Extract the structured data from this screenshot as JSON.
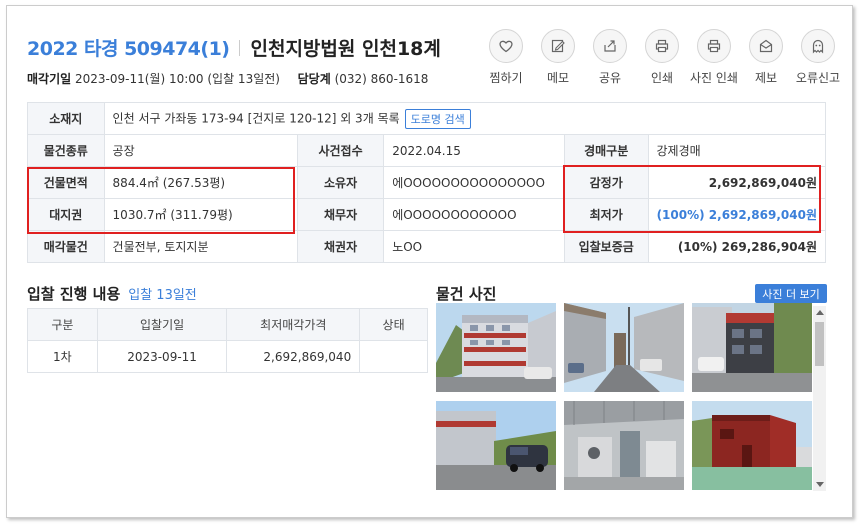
{
  "header": {
    "case_no": "2022 타경 509474(1)",
    "court": "인천지방법원 인천18계",
    "sale_date_label": "매각기일",
    "sale_date": "2023-09-11(월) 10:00 (입찰 13일전)",
    "dept_label": "담당계",
    "dept_phone": "(032) 860-1618"
  },
  "actions": [
    {
      "label": "찜하기",
      "icon": "heart-icon"
    },
    {
      "label": "메모",
      "icon": "memo-icon"
    },
    {
      "label": "공유",
      "icon": "share-icon"
    },
    {
      "label": "인쇄",
      "icon": "print-icon"
    },
    {
      "label": "사진 인쇄",
      "icon": "print-photo-icon"
    },
    {
      "label": "제보",
      "icon": "report-mail-icon"
    },
    {
      "label": "오류신고",
      "icon": "error-report-icon"
    }
  ],
  "info": {
    "location_label": "소재지",
    "location": "인천 서구 가좌동 173-94 [건지로 120-12] 외 3개 목록",
    "road_search": "도로명 검색",
    "type_label": "물건종류",
    "type": "공장",
    "filed_label": "사건접수",
    "filed": "2022.04.15",
    "auction_kind_label": "경매구분",
    "auction_kind": "강제경매",
    "building_area_label": "건물면적",
    "building_area": "884.4㎡ (267.53평)",
    "owner_label": "소유자",
    "owner": "에OOOOOOOOOOOOOOO",
    "appraisal_label": "감정가",
    "appraisal": "2,692,869,040원",
    "land_label": "대지권",
    "land_area": "1030.7㎡ (311.79평)",
    "debtor_label": "채무자",
    "debtor": "에OOOOOOOOOOOO",
    "min_price_label": "최저가",
    "min_price": "(100%) 2,692,869,040원",
    "sale_item_label": "매각물건",
    "sale_item": "건물전부, 토지지분",
    "creditor_label": "채권자",
    "creditor": "노OO",
    "deposit_label": "입찰보증금",
    "deposit": "(10%) 269,286,904원"
  },
  "bid": {
    "title": "입찰 진행 내용",
    "subtitle": "입찰 13일전",
    "columns": [
      "구분",
      "입찰기일",
      "최저매각가격",
      "상태"
    ],
    "rows": [
      {
        "round": "1차",
        "date": "2023-09-11",
        "price": "2,692,869,040",
        "status": ""
      }
    ]
  },
  "photos": {
    "title": "물건 사진",
    "more_button": "사진 더 보기"
  },
  "colors": {
    "accent": "#3b7fd9",
    "highlight_box": "#e02020"
  }
}
